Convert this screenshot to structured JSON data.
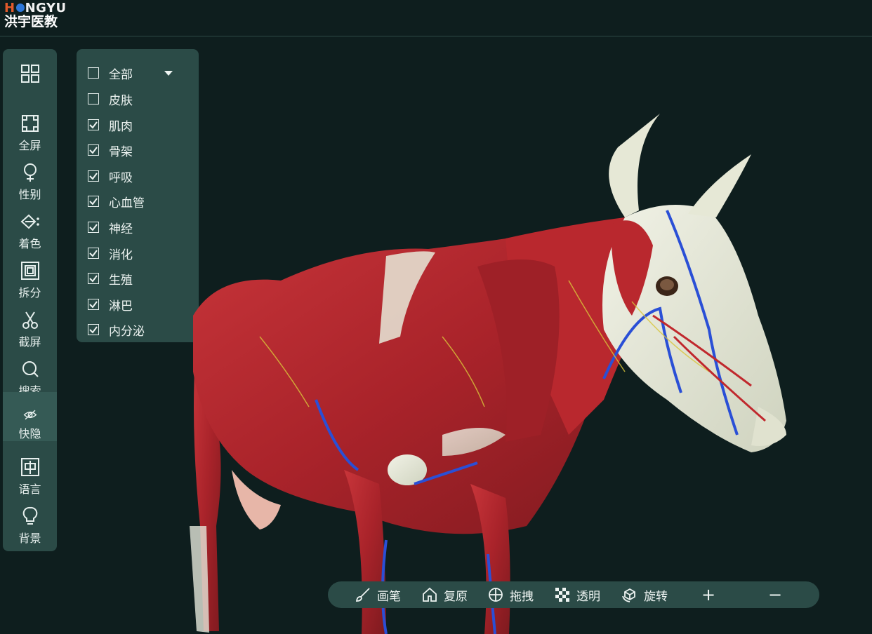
{
  "brand": {
    "name_en_pre": "H",
    "name_en_post": "NGYU",
    "name_cn": "洪宇医教"
  },
  "sidebar": {
    "items": [
      {
        "label": "",
        "icon": "grid-icon"
      },
      {
        "label": "全屏",
        "icon": "fullscreen-icon"
      },
      {
        "label": "性别",
        "icon": "gender-icon"
      },
      {
        "label": "着色",
        "icon": "paint-icon"
      },
      {
        "label": "拆分",
        "icon": "split-icon"
      },
      {
        "label": "截屏",
        "icon": "scissors-icon"
      },
      {
        "label": "搜索",
        "icon": "search-icon"
      },
      {
        "label": "快隐",
        "icon": "hide-eye-icon",
        "active": true
      },
      {
        "label": "语言",
        "icon": "language-icon"
      },
      {
        "label": "背景",
        "icon": "bulb-icon"
      }
    ]
  },
  "layers": {
    "all_label": "全部",
    "items": [
      {
        "label": "全部",
        "checked": false
      },
      {
        "label": "皮肤",
        "checked": false
      },
      {
        "label": "肌肉",
        "checked": true
      },
      {
        "label": "骨架",
        "checked": true
      },
      {
        "label": "呼吸",
        "checked": true
      },
      {
        "label": "心血管",
        "checked": true
      },
      {
        "label": "神经",
        "checked": true
      },
      {
        "label": "消化",
        "checked": true
      },
      {
        "label": "生殖",
        "checked": true
      },
      {
        "label": "淋巴",
        "checked": true
      },
      {
        "label": "内分泌",
        "checked": true
      }
    ]
  },
  "toolbar": {
    "brush": "画笔",
    "reset": "复原",
    "drag": "拖拽",
    "transparent": "透明",
    "rotate": "旋转",
    "zoom_in": "+",
    "zoom_out": "−"
  },
  "colors": {
    "background": "#0e1e1e",
    "panel": "#2b4b47",
    "muscle": "#b3262a",
    "bone": "#e6e9d8",
    "vein": "#2a4fd6"
  }
}
